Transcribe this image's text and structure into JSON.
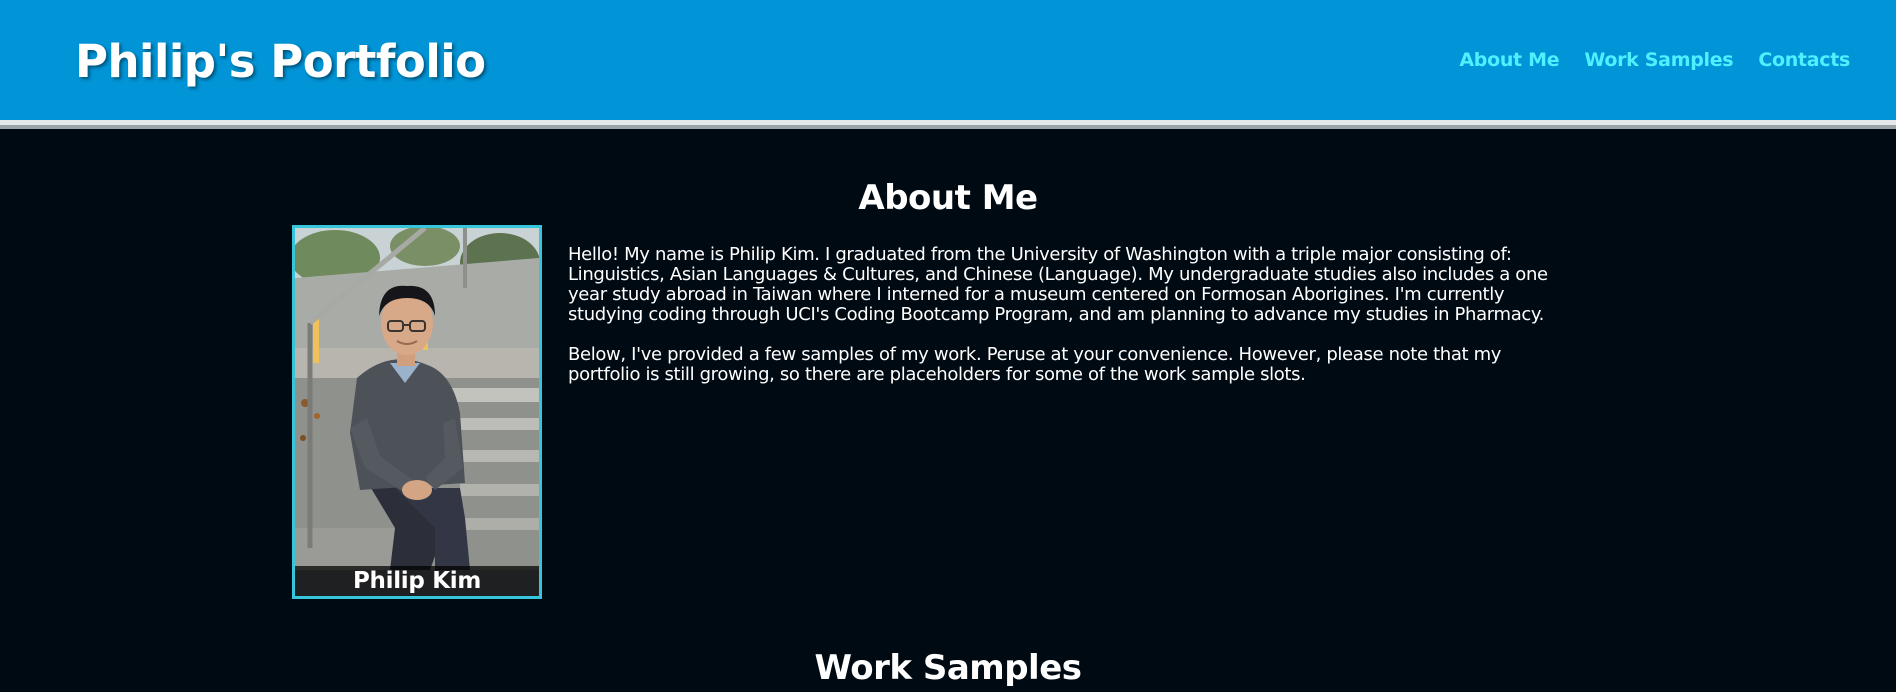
{
  "header": {
    "title": "Philip's Portfolio",
    "nav": [
      {
        "label": "About Me"
      },
      {
        "label": "Work Samples"
      },
      {
        "label": "Contacts"
      }
    ]
  },
  "about": {
    "heading": "About Me",
    "photo_caption": "Philip Kim",
    "paragraphs": [
      "Hello! My name is Philip Kim. I graduated from the University of Washington with a triple major consisting of: Linguistics, Asian Languages & Cultures, and Chinese (Language). My undergraduate studies also includes a one year study abroad in Taiwan where I interned for a museum centered on Formosan Aborigines. I'm currently studying coding through UCI's Coding Bootcamp Program, and am planning to advance my studies in Pharmacy.",
      "Below, I've provided a few samples of my work. Peruse at your convenience. However, please note that my portfolio is still growing, so there are placeholders for some of the work sample slots."
    ]
  },
  "work": {
    "heading": "Work Samples"
  },
  "colors": {
    "header_bg": "#0194d6",
    "page_bg": "#000a12",
    "nav_link": "#4ff0ff",
    "card_border": "#36c6dc"
  }
}
